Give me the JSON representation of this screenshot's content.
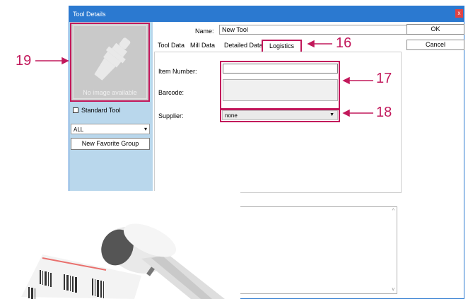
{
  "window": {
    "title": "Tool Details",
    "close_label": "x"
  },
  "left_panel": {
    "image_placeholder_text": "No image available",
    "standard_tool_label": "Standard Tool",
    "standard_tool_checked": false,
    "group_select_value": "ALL",
    "new_favorite_group_label": "New Favorite Group"
  },
  "form": {
    "name_label": "Name:",
    "name_value": "New Tool",
    "ok_label": "OK",
    "cancel_label": "Cancel"
  },
  "tabs": [
    {
      "label": "Tool Data"
    },
    {
      "label": "Mill Data"
    },
    {
      "label": "Detailed Data"
    },
    {
      "label": "Logistics",
      "active": true
    }
  ],
  "logistics": {
    "item_number_label": "Item Number:",
    "item_number_value": "",
    "barcode_label": "Barcode:",
    "barcode_value": "",
    "supplier_label": "Supplier:",
    "supplier_value": "none"
  },
  "callouts": {
    "c16": "16",
    "c17": "17",
    "c18": "18",
    "c19": "19"
  },
  "colors": {
    "titlebar": "#2b79d0",
    "left_panel": "#b9d7ec",
    "highlight": "#c2185b",
    "close": "#e04343"
  },
  "icons": [
    "tool-holder-icon",
    "dropdown-arrow-icon",
    "scroll-up-icon",
    "scroll-down-icon",
    "barcode-scanner-image"
  ]
}
